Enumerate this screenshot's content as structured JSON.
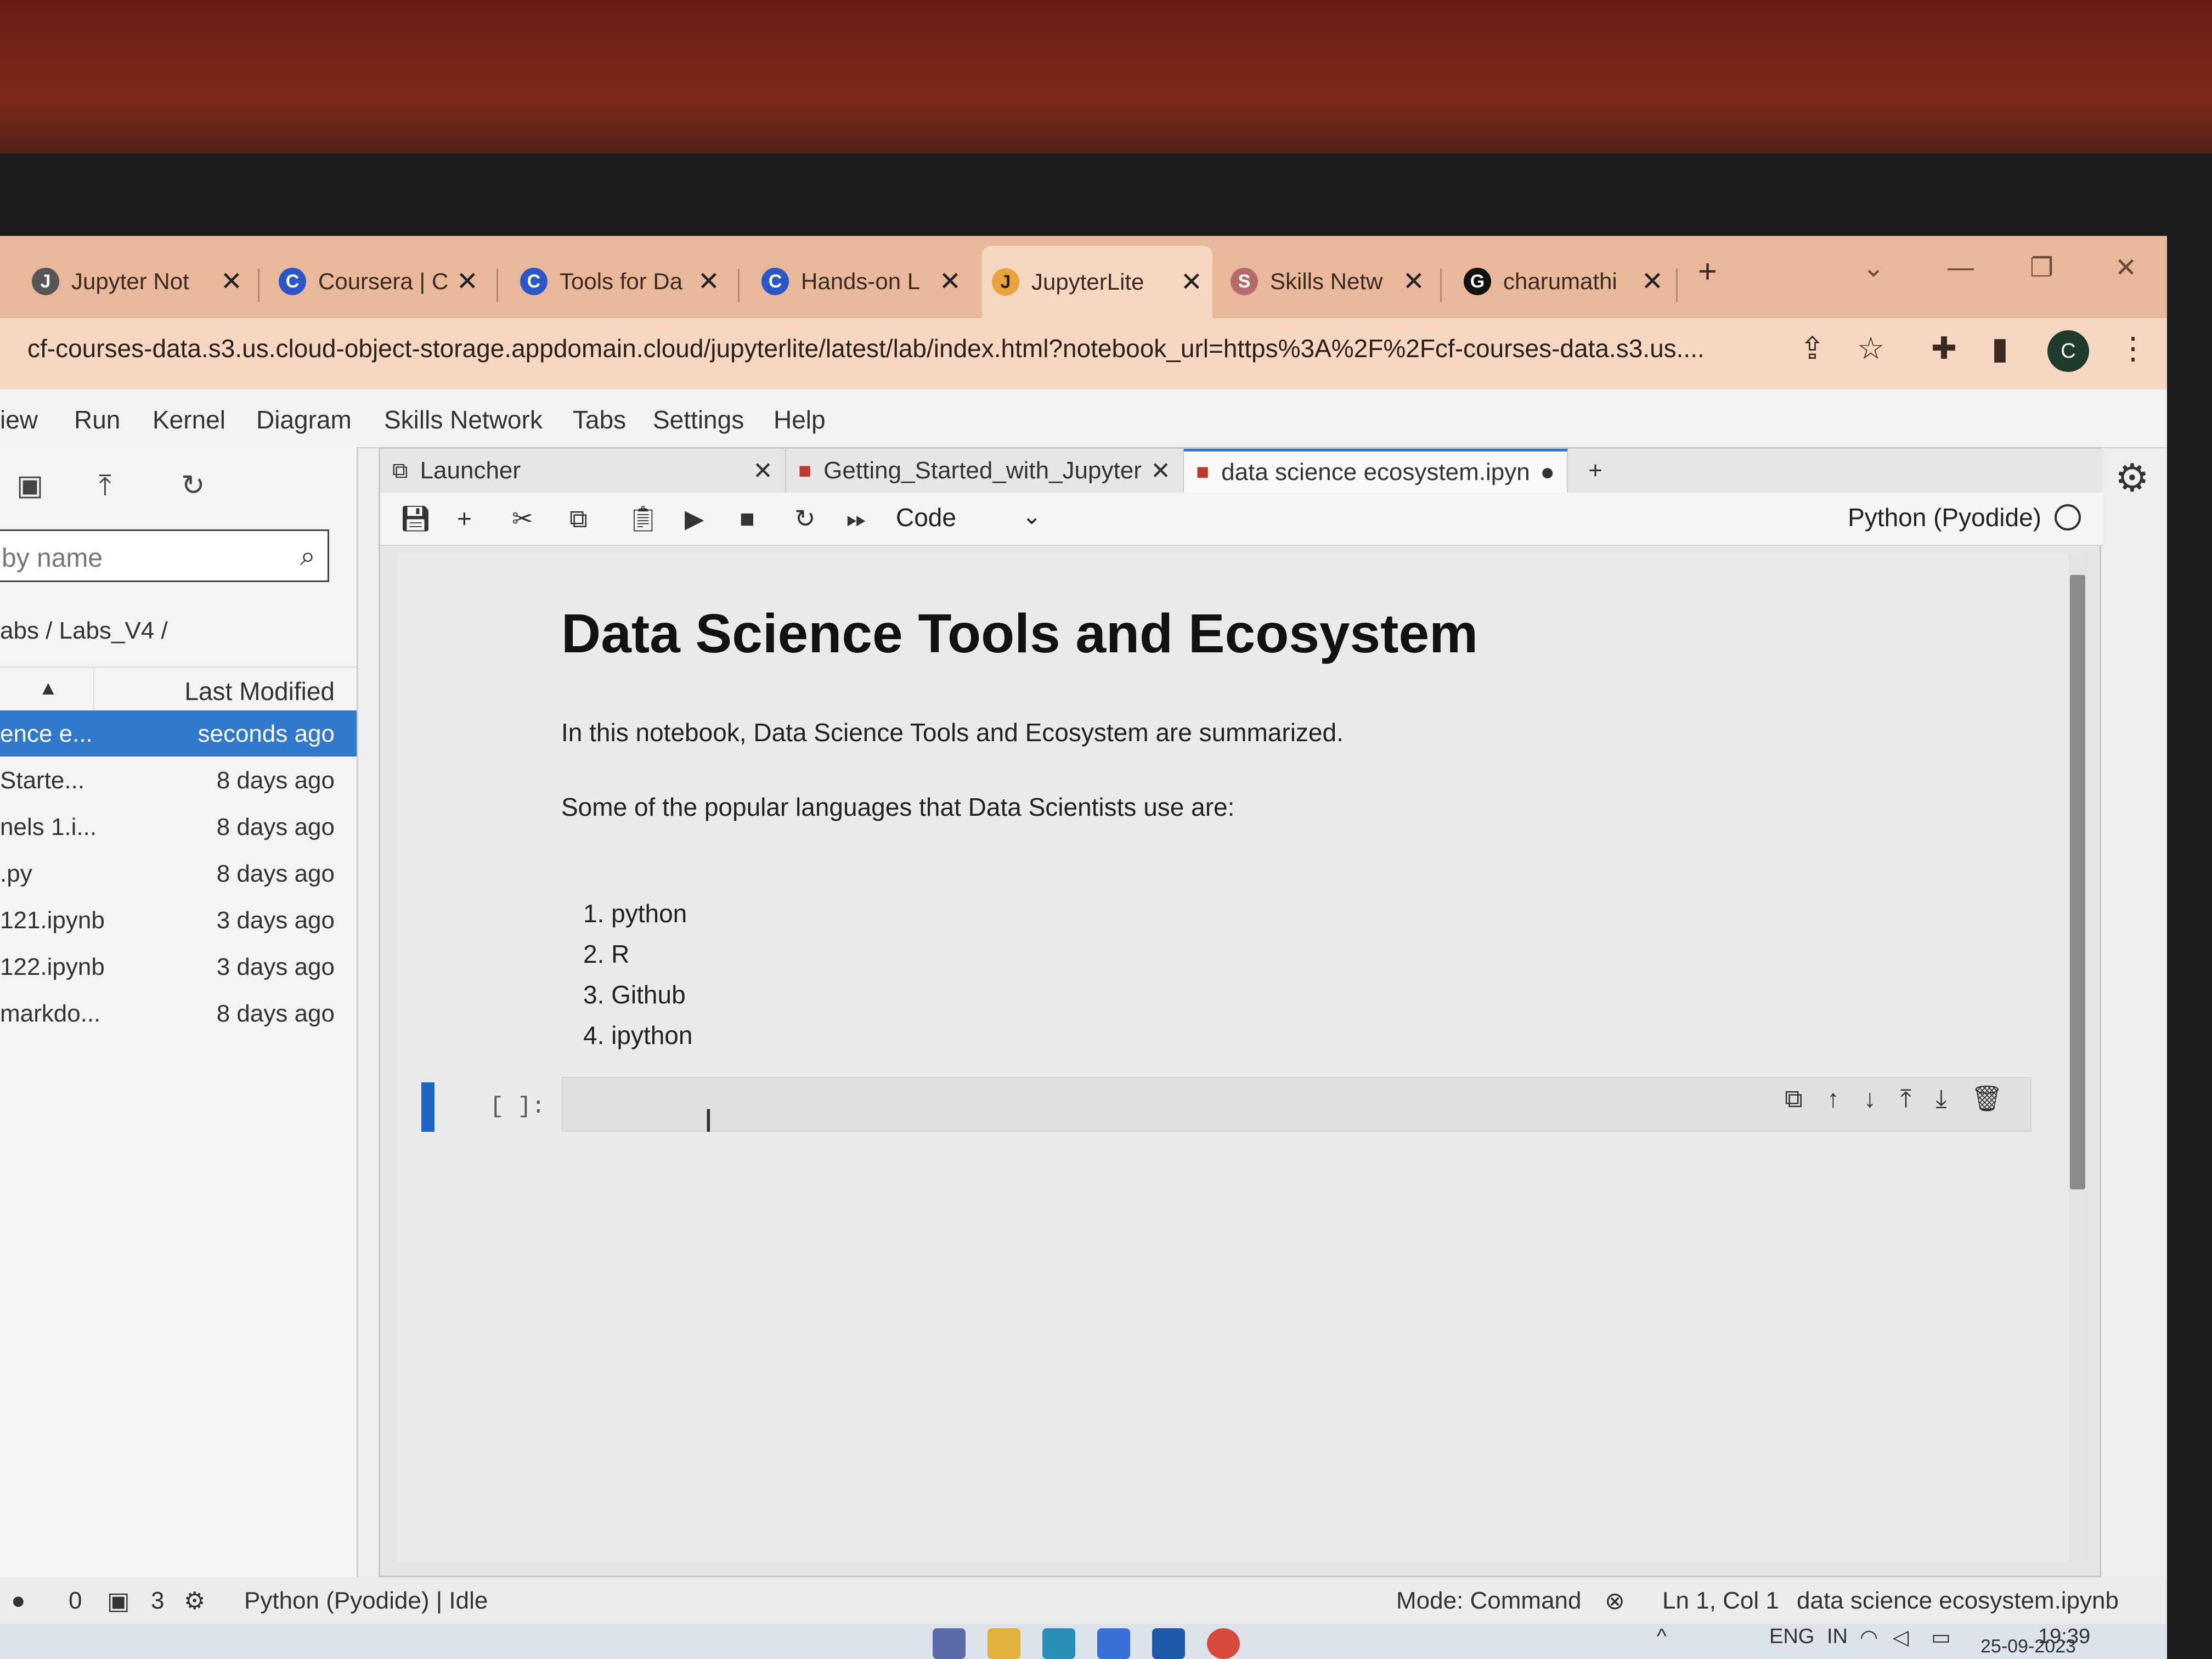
{
  "browser": {
    "tabs": [
      {
        "label": "Jupyter Not",
        "icon": "jupyter-icon"
      },
      {
        "label": "Coursera | C",
        "icon": "coursera-icon"
      },
      {
        "label": "Tools for Da",
        "icon": "coursera-icon"
      },
      {
        "label": "Hands-on L",
        "icon": "coursera-icon"
      },
      {
        "label": "JupyterLite",
        "icon": "jupyterlite-icon",
        "active": true
      },
      {
        "label": "Skills Netw",
        "icon": "skills-network-icon"
      },
      {
        "label": "charumathi",
        "icon": "github-icon"
      }
    ],
    "new_tab": "+",
    "url": "cf-courses-data.s3.us.cloud-object-storage.appdomain.cloud/jupyterlite/latest/lab/index.html?notebook_url=https%3A%2F%2Fcf-courses-data.s3.us....",
    "profile_initial": "C"
  },
  "menu": [
    "iew",
    "Run",
    "Kernel",
    "Diagram",
    "Skills Network",
    "Tabs",
    "Settings",
    "Help"
  ],
  "sidebar": {
    "filter_placeholder": "by name",
    "breadcrumb": "abs / Labs_V4 /",
    "column_modified": "Last Modified",
    "files": [
      {
        "name": "ence e...",
        "modified": "seconds ago",
        "selected": true
      },
      {
        "name": "Starte...",
        "modified": "8 days ago"
      },
      {
        "name": "nels 1.i...",
        "modified": "8 days ago"
      },
      {
        "name": ".py",
        "modified": "8 days ago"
      },
      {
        "name": "121.ipynb",
        "modified": "3 days ago"
      },
      {
        "name": "122.ipynb",
        "modified": "3 days ago"
      },
      {
        "name": "markdo...",
        "modified": "8 days ago"
      }
    ]
  },
  "doc_tabs": [
    {
      "label": "Launcher"
    },
    {
      "label": "Getting_Started_with_Jupyter"
    },
    {
      "label": "data science ecosystem.ipynb",
      "active": true
    }
  ],
  "toolbar": {
    "cell_type": "Code",
    "kernel": "Python (Pyodide)"
  },
  "notebook": {
    "title": "Data Science Tools and Ecosystem",
    "intro": "In this notebook, Data Science Tools and Ecosystem are summarized.",
    "languages_intro": "Some of the popular languages that Data Scientists use are:",
    "languages": [
      "1. python",
      "2. R",
      "3. Github",
      "4. ipython"
    ],
    "prompt": "[ ]:"
  },
  "status": {
    "counter_a": "0",
    "counter_b": "3",
    "kernel_state": "Python (Pyodide) | Idle",
    "mode": "Mode: Command",
    "position": "Ln 1, Col 1",
    "filename": "data science ecosystem.ipynb"
  },
  "taskbar": {
    "lang": "ENG",
    "region": "IN",
    "time": "19:39",
    "date": "25-09-2023"
  },
  "colors": {
    "accent": "#2f78cc",
    "chrome": "#e9b79a",
    "cell_marker": "#1f63c6"
  }
}
